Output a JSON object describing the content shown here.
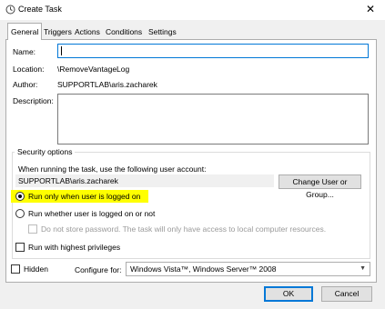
{
  "window": {
    "title": "Create Task",
    "close_glyph": "✕"
  },
  "tabs": [
    {
      "label": "General"
    },
    {
      "label": "Triggers"
    },
    {
      "label": "Actions"
    },
    {
      "label": "Conditions"
    },
    {
      "label": "Settings"
    }
  ],
  "general": {
    "name_label": "Name:",
    "name_value": "",
    "location_label": "Location:",
    "location_value": "\\RemoveVantageLog",
    "author_label": "Author:",
    "author_value": "SUPPORTLAB\\aris.zacharek",
    "description_label": "Description:",
    "description_value": ""
  },
  "security": {
    "group_label": "Security options",
    "account_prompt": "When running the task, use the following user account:",
    "account_value": "SUPPORTLAB\\aris.zacharek",
    "change_user_button": "Change User or Group...",
    "run_logged_on_label": "Run only when user is logged on",
    "run_whether_label": "Run whether user is logged on or not",
    "dont_store_password_label": "Do not store password.  The task will only have access to local computer resources.",
    "highest_privileges_label": "Run with highest privileges",
    "selected_option": "run_logged_on"
  },
  "footer": {
    "hidden_label": "Hidden",
    "configure_label": "Configure for:",
    "configure_value": "Windows Vista™, Windows Server™ 2008",
    "ok_label": "OK",
    "cancel_label": "Cancel"
  },
  "colors": {
    "accent": "#0078d7",
    "highlight": "#ffff00"
  }
}
